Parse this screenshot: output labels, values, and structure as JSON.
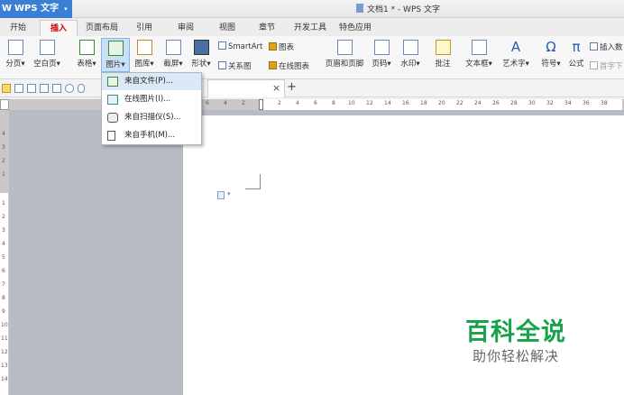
{
  "app": {
    "name": "WPS 文字",
    "logo": "W",
    "window_title": "文档1 * - WPS 文字"
  },
  "tabs": [
    {
      "label": "开始"
    },
    {
      "label": "插入",
      "active": true
    },
    {
      "label": "页面布局"
    },
    {
      "label": "引用"
    },
    {
      "label": "审阅"
    },
    {
      "label": "视图"
    },
    {
      "label": "章节"
    },
    {
      "label": "开发工具"
    },
    {
      "label": "特色应用"
    }
  ],
  "ribbon": {
    "page_break": "分页",
    "blank_page": "空白页",
    "table": "表格",
    "picture": "图片",
    "gallery": "图库",
    "screenshot": "截屏",
    "shapes": "形状",
    "smartart": "SmartArt",
    "chart": "图表",
    "relation": "关系图",
    "online_chart": "在线图表",
    "header_footer": "页眉和页脚",
    "page_number": "页码",
    "watermark": "水印",
    "comment": "批注",
    "textbox": "文本框",
    "wordart": "艺术字",
    "symbol": "符号",
    "formula": "公式",
    "insert_num": "插入数",
    "first_drop": "首字下"
  },
  "dropdown_arrow": "▾",
  "picture_menu": [
    {
      "label": "来自文件(P)...",
      "icon": "image-file-icon",
      "highlighted": true
    },
    {
      "label": "在线图片(I)...",
      "icon": "online-image-icon"
    },
    {
      "label": "来自扫描仪(S)...",
      "icon": "scanner-icon"
    },
    {
      "label": "来自手机(M)...",
      "icon": "phone-icon"
    }
  ],
  "doc_tab": {
    "close": "×",
    "add": "+"
  },
  "ruler": {
    "labels": [
      "6",
      "4",
      "2",
      "2",
      "4",
      "6",
      "8",
      "10",
      "12",
      "14",
      "16",
      "18",
      "20",
      "22",
      "24",
      "26",
      "28",
      "30",
      "32",
      "34",
      "36",
      "38"
    ]
  },
  "vertical_ruler": [
    "4",
    "3",
    "2",
    "1",
    "1",
    "2",
    "3",
    "4",
    "5",
    "6",
    "7",
    "8",
    "9",
    "10",
    "11",
    "12",
    "13",
    "14"
  ],
  "watermark": {
    "title": "百科全说",
    "subtitle": "助你轻松解决"
  },
  "colors": {
    "accent": "#3b7fd4",
    "active_tab": "#cc0000",
    "watermark_green": "#18a24a"
  }
}
